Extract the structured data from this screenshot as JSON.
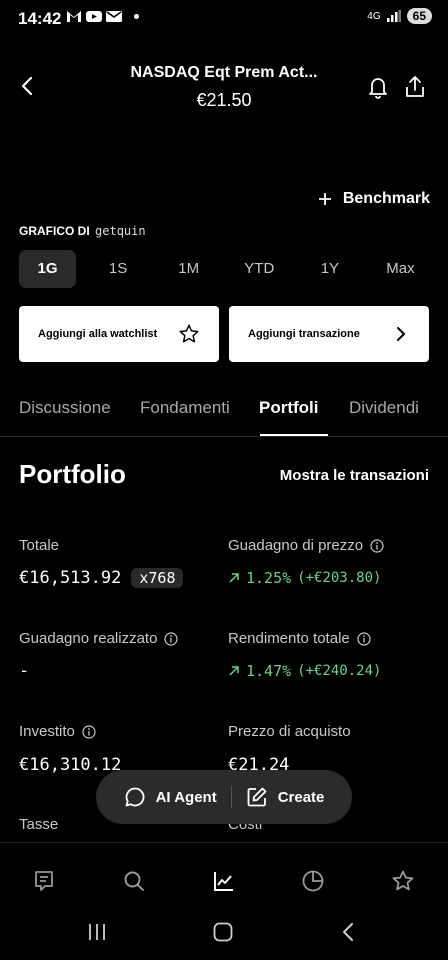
{
  "status": {
    "time": "14:42",
    "network": "4G",
    "battery": "65"
  },
  "header": {
    "title": "NASDAQ Eqt Prem Act...",
    "price": "€21.50"
  },
  "benchmark_label": "Benchmark",
  "chart_by": {
    "label": "GRAFICO DI",
    "brand": "getquin"
  },
  "ranges": [
    "1G",
    "1S",
    "1M",
    "YTD",
    "1Y",
    "Max"
  ],
  "actions": {
    "watchlist": "Aggiungi alla watchlist",
    "transaction": "Aggiungi transazione"
  },
  "tabs": [
    "Discussione",
    "Fondamenti",
    "Portfoli",
    "Dividendi"
  ],
  "portfolio": {
    "title": "Portfolio",
    "show_transactions": "Mostra le transazioni",
    "total_label": "Totale",
    "total_value": "€16,513.92",
    "quantity": "x768",
    "price_gain_label": "Guadagno di prezzo",
    "price_gain_value": "1.25%",
    "price_gain_abs": "(+€203.80)",
    "realized_label": "Guadagno realizzato",
    "realized_value": "-",
    "total_return_label": "Rendimento totale",
    "total_return_value": "1.47%",
    "total_return_abs": "(+€240.24)",
    "invested_label": "Investito",
    "invested_value": "€16,310.12",
    "purchase_price_label": "Prezzo di acquisto",
    "purchase_price_value": "€21.24",
    "taxes_label": "Tasse",
    "costs_label": "Costi"
  },
  "pill": {
    "agent": "AI Agent",
    "create": "Create"
  },
  "colors": {
    "gain": "#6ad28a",
    "background": "#000000"
  }
}
